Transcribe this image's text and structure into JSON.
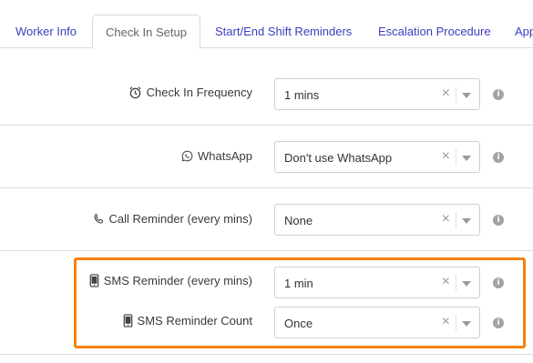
{
  "tabs": [
    {
      "label": "Worker Info",
      "active": false
    },
    {
      "label": "Check In Setup",
      "active": true
    },
    {
      "label": "Start/End Shift Reminders",
      "active": false
    },
    {
      "label": "Escalation Procedure",
      "active": false
    },
    {
      "label": "App",
      "active": false
    }
  ],
  "fields": {
    "check_in_frequency": {
      "label": "Check In Frequency",
      "value": "1 mins",
      "icon": "alarm-clock-icon"
    },
    "whatsapp": {
      "label": "WhatsApp",
      "value": "Don't use WhatsApp",
      "icon": "whatsapp-icon"
    },
    "call_reminder": {
      "label": "Call Reminder (every mins)",
      "value": "None",
      "icon": "phone-icon"
    },
    "sms_reminder": {
      "label": "SMS Reminder (every mins)",
      "value": "1 min",
      "icon": "mobile-phone-icon"
    },
    "sms_reminder_count": {
      "label": "SMS Reminder Count",
      "value": "Once",
      "icon": "mobile-phone-icon"
    }
  },
  "clear_symbol": "×",
  "info_symbol": "i",
  "colors": {
    "tab_link": "#3d3dbf",
    "highlight_border": "#f5820f",
    "info_icon": "#a3a3a3"
  }
}
